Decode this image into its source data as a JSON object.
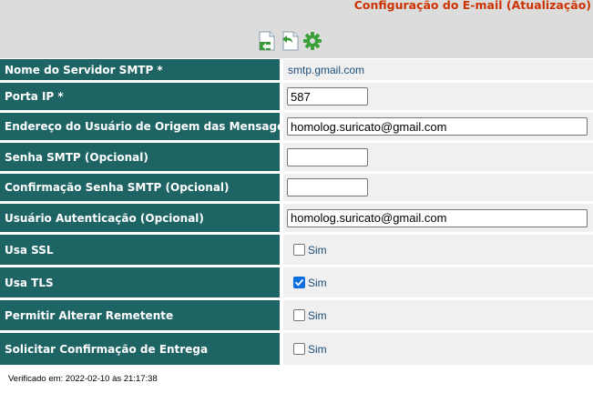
{
  "header": {
    "title": "Configuração do E-mail (Atualização)",
    "toolbar": [
      {
        "icon": "save-document-icon"
      },
      {
        "icon": "undo-document-icon"
      },
      {
        "icon": "gear-icon"
      }
    ]
  },
  "colors": {
    "label_bg": "#1e6464",
    "title": "#cc3300",
    "value_text": "#1e4d7a",
    "checkbox_on": "#0b6fe0"
  },
  "form": {
    "smtp_server": {
      "label": "Nome do Servidor SMTP *",
      "value": "smtp.gmail.com"
    },
    "port": {
      "label": "Porta IP *",
      "value": "587"
    },
    "sender": {
      "label": "Endereço do Usuário de Origem das Mensagens *",
      "value": "homolog.suricato@gmail.com"
    },
    "password": {
      "label": "Senha SMTP (Opcional)",
      "value": ""
    },
    "password_confirm": {
      "label": "Confirmação Senha SMTP (Opcional)",
      "value": ""
    },
    "auth_user": {
      "label": "Usuário Autenticação (Opcional)",
      "value": "homolog.suricato@gmail.com"
    },
    "use_ssl": {
      "label": "Usa SSL",
      "option": "Sim",
      "checked": false
    },
    "use_tls": {
      "label": "Usa TLS",
      "option": "Sim",
      "checked": true
    },
    "allow_change_sender": {
      "label": "Permitir Alterar Remetente",
      "option": "Sim",
      "checked": false
    },
    "request_delivery_confirm": {
      "label": "Solicitar Confirmação de Entrega",
      "option": "Sim",
      "checked": false
    }
  },
  "footer": {
    "verified": "Verificado em: 2022-02-10 às 21:17:38"
  }
}
